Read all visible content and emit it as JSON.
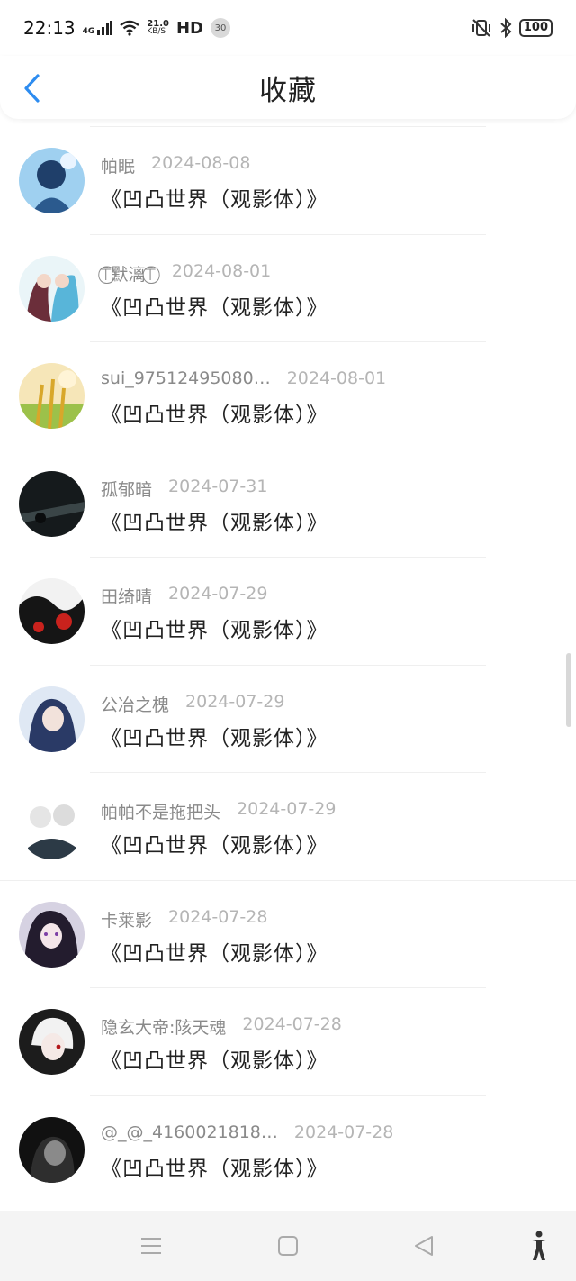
{
  "status_bar": {
    "time": "22:13",
    "network": "4G",
    "speed_value": "21.0",
    "speed_unit": "KB/S",
    "hd": "HD",
    "notification_count": "30",
    "battery": "100"
  },
  "header": {
    "title": "收藏"
  },
  "items": [
    {
      "username": "帕眠",
      "date": "2024-08-08",
      "book": "《凹凸世界（观影体）》"
    },
    {
      "username": "⍑⃝默漓⍑⃝",
      "date": "2024-08-01",
      "book": "《凹凸世界（观影体）》"
    },
    {
      "username": "sui_97512495080…",
      "date": "2024-08-01",
      "book": "《凹凸世界（观影体）》"
    },
    {
      "username": "孤郁暗",
      "date": "2024-07-31",
      "book": "《凹凸世界（观影体）》"
    },
    {
      "username": "田绮晴",
      "date": "2024-07-29",
      "book": "《凹凸世界（观影体）》"
    },
    {
      "username": "公冶之槐",
      "date": "2024-07-29",
      "book": "《凹凸世界（观影体）》"
    },
    {
      "username": "帕帕不是拖把头",
      "date": "2024-07-29",
      "book": "《凹凸世界（观影体）》"
    },
    {
      "username": "卡莱影",
      "date": "2024-07-28",
      "book": "《凹凸世界（观影体）》"
    },
    {
      "username": "隐玄大帝:陔天魂",
      "date": "2024-07-28",
      "book": "《凹凸世界（观影体）》"
    },
    {
      "username": "@_@_4160021818…",
      "date": "2024-07-28",
      "book": "《凹凸世界（观影体）》"
    }
  ],
  "colors": {
    "accent": "#2d8cf0",
    "username": "#8a8a8a",
    "date": "#b5b5b5"
  },
  "icons": {
    "back": "back-arrow-icon",
    "menu": "menu-icon",
    "home": "home-icon",
    "back_nav": "back-triangle-icon",
    "accessibility": "accessibility-icon"
  }
}
